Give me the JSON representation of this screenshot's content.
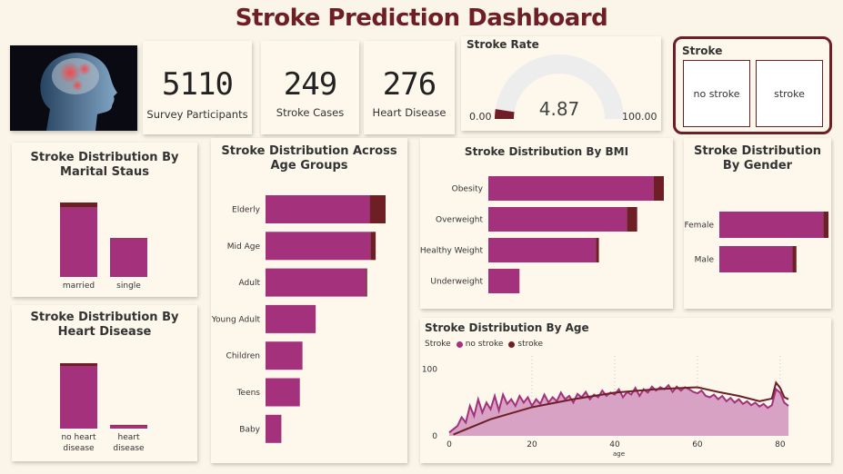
{
  "header": {
    "title": "Stroke Prediction Dashboard"
  },
  "kpis": [
    {
      "value": "5110",
      "label": "Survey Participants"
    },
    {
      "value": "249",
      "label": "Stroke Cases"
    },
    {
      "value": "276",
      "label": "Heart Disease"
    }
  ],
  "gauge": {
    "title": "Stroke Rate",
    "value": "4.87",
    "min": "0.00",
    "max": "100.00",
    "fraction": 0.0487
  },
  "slicer": {
    "title": "Stroke",
    "options": [
      "no stroke",
      "stroke"
    ]
  },
  "colors": {
    "no_stroke": "#a3317b",
    "stroke": "#6e1f26",
    "area": "#d7a2c4",
    "title": "#6e1f26"
  },
  "chart_data": [
    {
      "type": "bar",
      "title": "Stroke Distribution By Marital Staus",
      "categories": [
        "married",
        "single"
      ],
      "series": [
        {
          "name": "no stroke",
          "values": [
            3133,
            1728
          ]
        },
        {
          "name": "stroke",
          "values": [
            220,
            29
          ]
        }
      ]
    },
    {
      "type": "bar",
      "title": "Stroke Distribution By Heart Disease",
      "categories": [
        "no heart disease",
        "heart disease"
      ],
      "series": [
        {
          "name": "no stroke",
          "values": [
            4632,
            229
          ]
        },
        {
          "name": "stroke",
          "values": [
            202,
            47
          ]
        }
      ]
    },
    {
      "type": "bar",
      "title": "Stroke Distribution Across Age Groups",
      "categories": [
        "Elderly",
        "Mid Age",
        "Adult",
        "Young Adult",
        "Children",
        "Teens",
        "Baby"
      ],
      "series": [
        {
          "name": "no stroke",
          "values": [
            790,
            795,
            760,
            380,
            280,
            260,
            120
          ]
        },
        {
          "name": "stroke",
          "values": [
            120,
            40,
            10,
            0,
            0,
            0,
            0
          ]
        }
      ]
    },
    {
      "type": "bar",
      "title": "Stroke Distribution By BMI",
      "categories": [
        "Obesity",
        "Overweight",
        "Healthy Weight",
        "Underweight"
      ],
      "series": [
        {
          "name": "no stroke",
          "values": [
            1920,
            1610,
            1250,
            360
          ]
        },
        {
          "name": "stroke",
          "values": [
            120,
            120,
            35,
            2
          ]
        }
      ]
    },
    {
      "type": "bar",
      "title": "Stroke Distribution By Gender",
      "categories": [
        "Female",
        "Male"
      ],
      "series": [
        {
          "name": "no stroke",
          "values": [
            2853,
            2007
          ]
        },
        {
          "name": "stroke",
          "values": [
            141,
            108
          ]
        }
      ]
    },
    {
      "type": "area",
      "title": "Stroke Distribution By Age",
      "xlabel": "age",
      "legend_title": "Stroke",
      "xlim": [
        0,
        82
      ],
      "ylim": [
        0,
        120
      ],
      "xticks": [
        0,
        20,
        40,
        60,
        80
      ],
      "yticks": [
        0,
        100
      ],
      "series": [
        {
          "name": "no stroke",
          "points": [
            [
              0,
              5
            ],
            [
              1,
              10
            ],
            [
              2,
              15
            ],
            [
              3,
              28
            ],
            [
              4,
              20
            ],
            [
              5,
              45
            ],
            [
              6,
              30
            ],
            [
              7,
              55
            ],
            [
              8,
              35
            ],
            [
              9,
              50
            ],
            [
              10,
              40
            ],
            [
              11,
              60
            ],
            [
              12,
              38
            ],
            [
              13,
              62
            ],
            [
              14,
              48
            ],
            [
              15,
              55
            ],
            [
              16,
              45
            ],
            [
              17,
              60
            ],
            [
              18,
              50
            ],
            [
              19,
              58
            ],
            [
              20,
              45
            ],
            [
              21,
              55
            ],
            [
              22,
              48
            ],
            [
              23,
              62
            ],
            [
              24,
              50
            ],
            [
              25,
              58
            ],
            [
              26,
              52
            ],
            [
              27,
              65
            ],
            [
              28,
              55
            ],
            [
              29,
              60
            ],
            [
              30,
              50
            ],
            [
              31,
              63
            ],
            [
              32,
              58
            ],
            [
              33,
              66
            ],
            [
              34,
              55
            ],
            [
              35,
              62
            ],
            [
              36,
              58
            ],
            [
              37,
              68
            ],
            [
              38,
              60
            ],
            [
              39,
              65
            ],
            [
              40,
              62
            ],
            [
              41,
              70
            ],
            [
              42,
              58
            ],
            [
              43,
              66
            ],
            [
              44,
              62
            ],
            [
              45,
              72
            ],
            [
              46,
              60
            ],
            [
              47,
              70
            ],
            [
              48,
              65
            ],
            [
              49,
              74
            ],
            [
              50,
              68
            ],
            [
              51,
              73
            ],
            [
              52,
              70
            ],
            [
              53,
              76
            ],
            [
              54,
              66
            ],
            [
              55,
              74
            ],
            [
              56,
              68
            ],
            [
              57,
              73
            ],
            [
              58,
              70
            ],
            [
              59,
              66
            ],
            [
              60,
              64
            ],
            [
              61,
              68
            ],
            [
              62,
              60
            ],
            [
              63,
              58
            ],
            [
              64,
              62
            ],
            [
              65,
              55
            ],
            [
              66,
              60
            ],
            [
              67,
              52
            ],
            [
              68,
              57
            ],
            [
              69,
              50
            ],
            [
              70,
              55
            ],
            [
              71,
              48
            ],
            [
              72,
              52
            ],
            [
              73,
              46
            ],
            [
              74,
              50
            ],
            [
              75,
              44
            ],
            [
              76,
              48
            ],
            [
              77,
              42
            ],
            [
              78,
              46
            ],
            [
              79,
              70
            ],
            [
              80,
              65
            ],
            [
              81,
              50
            ],
            [
              82,
              45
            ]
          ]
        },
        {
          "name": "stroke",
          "points": [
            [
              1,
              2
            ],
            [
              10,
              25
            ],
            [
              20,
              43
            ],
            [
              30,
              55
            ],
            [
              40,
              65
            ],
            [
              50,
              70
            ],
            [
              60,
              73
            ],
            [
              65,
              66
            ],
            [
              70,
              60
            ],
            [
              75,
              52
            ],
            [
              78,
              56
            ],
            [
              79,
              80
            ],
            [
              80,
              72
            ],
            [
              81,
              58
            ],
            [
              82,
              55
            ]
          ]
        }
      ]
    }
  ]
}
